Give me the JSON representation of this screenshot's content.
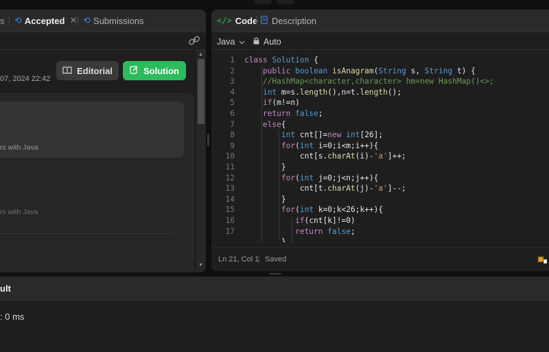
{
  "left_panel": {
    "tabs": {
      "prev_tail": "s",
      "accepted": "Accepted",
      "submissions": "Submissions"
    },
    "submit_time": "07, 2024 22:42",
    "editorial_label": "Editorial",
    "solution_label": "Solution",
    "lang_note_1": "rs with Java",
    "lang_note_2": "rs with Java"
  },
  "code_panel": {
    "tabs": {
      "code": "Code",
      "description": "Description"
    },
    "language": "Java",
    "auto_label": "Auto",
    "line_numbers": [
      "1",
      "2",
      "3",
      "4",
      "5",
      "6",
      "7",
      "8",
      "9",
      "10",
      "11",
      "12",
      "13",
      "14",
      "15",
      "16",
      "17"
    ],
    "status_position": "Ln 21, Col 1",
    "status_saved": "Saved"
  },
  "bottom_panel": {
    "title_tail": "ult",
    "runtime_tail": ": 0 ms"
  },
  "colors": {
    "accent_green": "#2cbb5d",
    "keyword": "#c586c0",
    "type": "#569cd6",
    "comment": "#6a9955"
  }
}
